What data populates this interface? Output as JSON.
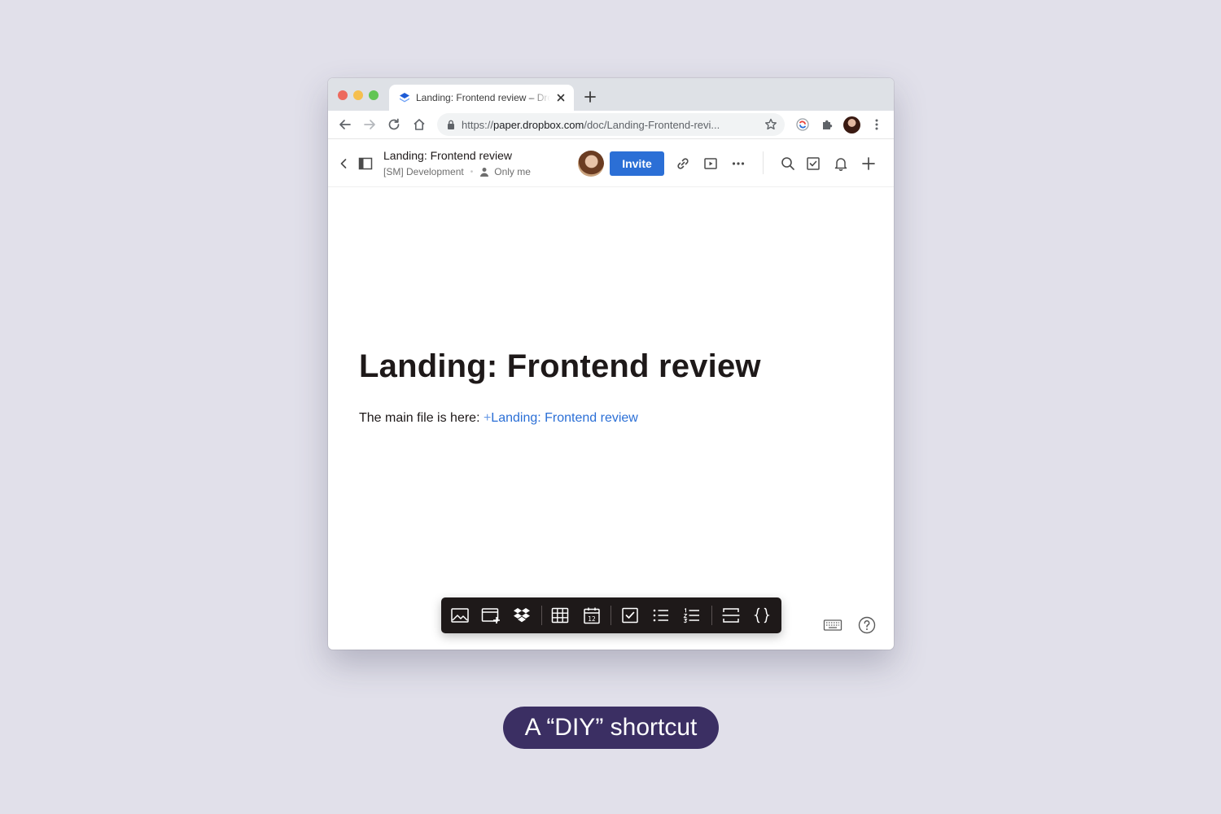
{
  "browser": {
    "tab_title": "Landing: Frontend review – Dropbox Paper",
    "url_scheme": "https://",
    "url_host": "paper.dropbox.com",
    "url_path": "/doc/Landing-Frontend-revi..."
  },
  "app_header": {
    "doc_title": "Landing: Frontend review",
    "folder": "[SM] Development",
    "sharing": "Only me",
    "invite_label": "Invite"
  },
  "document": {
    "heading": "Landing: Frontend review",
    "paragraph_prefix": "The main file is here: ",
    "link_plus": "+",
    "link_text": "Landing: Frontend review"
  },
  "format_toolbar": {
    "icons": [
      "image-icon",
      "media-embed-icon",
      "dropbox-icon",
      "table-icon",
      "calendar-icon",
      "checkbox-icon",
      "bullet-list-icon",
      "numbered-list-icon",
      "divider-icon",
      "code-block-icon"
    ],
    "calendar_day": "12"
  },
  "caption": "A “DIY” shortcut",
  "colors": {
    "accent": "#2b6fd6",
    "caption_bg": "#3b2f63",
    "toolbar_bg": "#1e1919",
    "page_bg": "#e1e0ea"
  }
}
